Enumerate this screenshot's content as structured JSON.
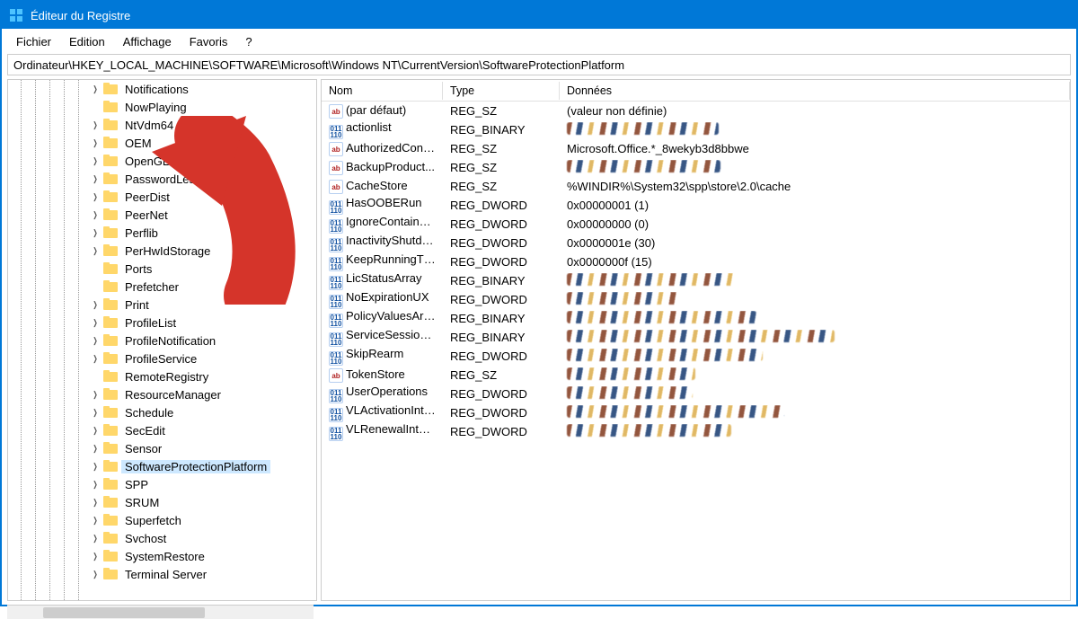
{
  "window": {
    "title": "Éditeur du Registre"
  },
  "menu": {
    "fichier": "Fichier",
    "edition": "Edition",
    "affichage": "Affichage",
    "favoris": "Favoris",
    "help": "?"
  },
  "address": {
    "path": "Ordinateur\\HKEY_LOCAL_MACHINE\\SOFTWARE\\Microsoft\\Windows NT\\CurrentVersion\\SoftwareProtectionPlatform"
  },
  "tree": {
    "items": [
      {
        "label": "Notifications",
        "expandable": true
      },
      {
        "label": "NowPlaying",
        "expandable": false
      },
      {
        "label": "NtVdm64",
        "expandable": true
      },
      {
        "label": "OEM",
        "expandable": true
      },
      {
        "label": "OpenGLDrivers",
        "expandable": true
      },
      {
        "label": "PasswordLess",
        "expandable": true
      },
      {
        "label": "PeerDist",
        "expandable": true
      },
      {
        "label": "PeerNet",
        "expandable": true
      },
      {
        "label": "Perflib",
        "expandable": true
      },
      {
        "label": "PerHwIdStorage",
        "expandable": true
      },
      {
        "label": "Ports",
        "expandable": false
      },
      {
        "label": "Prefetcher",
        "expandable": false
      },
      {
        "label": "Print",
        "expandable": true
      },
      {
        "label": "ProfileList",
        "expandable": true
      },
      {
        "label": "ProfileNotification",
        "expandable": true
      },
      {
        "label": "ProfileService",
        "expandable": true
      },
      {
        "label": "RemoteRegistry",
        "expandable": false
      },
      {
        "label": "ResourceManager",
        "expandable": true
      },
      {
        "label": "Schedule",
        "expandable": true
      },
      {
        "label": "SecEdit",
        "expandable": true
      },
      {
        "label": "Sensor",
        "expandable": true
      },
      {
        "label": "SoftwareProtectionPlatform",
        "expandable": true,
        "selected": true
      },
      {
        "label": "SPP",
        "expandable": true
      },
      {
        "label": "SRUM",
        "expandable": true
      },
      {
        "label": "Superfetch",
        "expandable": true
      },
      {
        "label": "Svchost",
        "expandable": true
      },
      {
        "label": "SystemRestore",
        "expandable": true
      },
      {
        "label": "Terminal Server",
        "expandable": true
      }
    ]
  },
  "columns": {
    "nom": "Nom",
    "type": "Type",
    "donnees": "Données"
  },
  "values": [
    {
      "name": "(par défaut)",
      "type": "REG_SZ",
      "data": "(valeur non définie)",
      "icon": "sz"
    },
    {
      "name": "actionlist",
      "type": "REG_BINARY",
      "data": "",
      "icon": "bin",
      "obscured": true
    },
    {
      "name": "AuthorizedCont...",
      "type": "REG_SZ",
      "data": "Microsoft.Office.*_8wekyb3d8bbwe",
      "icon": "sz"
    },
    {
      "name": "BackupProduct...",
      "type": "REG_SZ",
      "data": "",
      "icon": "sz",
      "obscured": true
    },
    {
      "name": "CacheStore",
      "type": "REG_SZ",
      "data": "%WINDIR%\\System32\\spp\\store\\2.0\\cache",
      "icon": "sz"
    },
    {
      "name": "HasOOBERun",
      "type": "REG_DWORD",
      "data": "0x00000001 (1)",
      "icon": "bin"
    },
    {
      "name": "IgnoreContainer...",
      "type": "REG_DWORD",
      "data": "0x00000000 (0)",
      "icon": "bin"
    },
    {
      "name": "InactivityShutdo...",
      "type": "REG_DWORD",
      "data": "0x0000001e (30)",
      "icon": "bin"
    },
    {
      "name": "KeepRunningTh...",
      "type": "REG_DWORD",
      "data": "0x0000000f (15)",
      "icon": "bin"
    },
    {
      "name": "LicStatusArray",
      "type": "REG_BINARY",
      "data": "",
      "icon": "bin",
      "obscured": true
    },
    {
      "name": "NoExpirationUX",
      "type": "REG_DWORD",
      "data": "",
      "icon": "bin",
      "obscured": true
    },
    {
      "name": "PolicyValuesArray",
      "type": "REG_BINARY",
      "data": "",
      "icon": "bin",
      "obscured": true
    },
    {
      "name": "ServiceSessionId",
      "type": "REG_BINARY",
      "data": "",
      "icon": "bin",
      "obscured": true
    },
    {
      "name": "SkipRearm",
      "type": "REG_DWORD",
      "data": "",
      "icon": "bin",
      "obscured": true
    },
    {
      "name": "TokenStore",
      "type": "REG_SZ",
      "data": "",
      "icon": "sz",
      "obscured": true
    },
    {
      "name": "UserOperations",
      "type": "REG_DWORD",
      "data": "",
      "icon": "bin",
      "obscured": true
    },
    {
      "name": "VLActivationInte...",
      "type": "REG_DWORD",
      "data": "",
      "icon": "bin",
      "obscured": true
    },
    {
      "name": "VLRenewalInterval",
      "type": "REG_DWORD",
      "data": "",
      "icon": "bin",
      "obscured": true
    }
  ]
}
